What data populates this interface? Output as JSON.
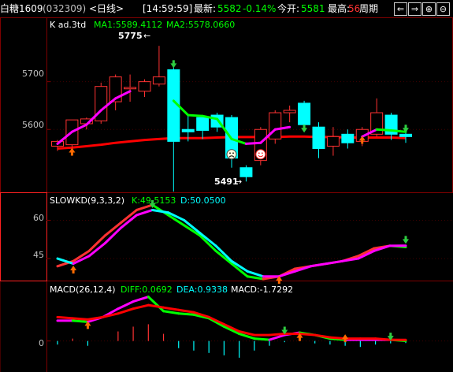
{
  "topbar": {
    "instrument": "白糖1609",
    "code": "(032309)",
    "period": "<日线>",
    "time": "[14:59:59]",
    "latest_label": "最新:",
    "latest_value": "5582",
    "change": "-0.14%",
    "open_label": "今开:",
    "open_value": "5581",
    "high_label": "最高:",
    "high_value": "56",
    "cycle_button": "周期",
    "nav_icons": [
      "arrow-left-icon",
      "arrow-right-icon",
      "zoom-in-icon",
      "zoom-out-icon"
    ],
    "nav_glyphs": [
      "⇐",
      "⇒",
      "⊕",
      "⊖"
    ]
  },
  "colors": {
    "background": "#000000",
    "grid": "#7f0000",
    "up": "#ff3232",
    "down": "#00ffff",
    "ma1": "#ff00ff",
    "ma2": "#00ff00",
    "ma_long": "#ff0000",
    "kdj_k": "#ff00ff",
    "kdj_d": "#00ffff",
    "diff": "#00ffff",
    "dea": "#ff0000"
  },
  "chart_data": [
    {
      "type": "candlestick",
      "title": "K  ad.3td",
      "legend": [
        {
          "label": "MA1:5589.4112",
          "color": "#00ff00"
        },
        {
          "label": "MA2:5578.0660",
          "color": "#00ff00"
        }
      ],
      "yticks": [
        5700,
        5600
      ],
      "ylim": [
        5475,
        5805
      ],
      "annotations": {
        "high": "5775",
        "low": "5491"
      },
      "candles": [
        {
          "o": 5565,
          "h": 5578,
          "l": 5555,
          "c": 5575
        },
        {
          "o": 5568,
          "h": 5605,
          "l": 5560,
          "c": 5620
        },
        {
          "o": 5612,
          "h": 5625,
          "l": 5600,
          "c": 5622
        },
        {
          "o": 5618,
          "h": 5698,
          "l": 5612,
          "c": 5690
        },
        {
          "o": 5658,
          "h": 5715,
          "l": 5640,
          "c": 5710
        },
        {
          "o": 5685,
          "h": 5715,
          "l": 5658,
          "c": 5688
        },
        {
          "o": 5680,
          "h": 5705,
          "l": 5668,
          "c": 5700
        },
        {
          "o": 5695,
          "h": 5775,
          "l": 5690,
          "c": 5710
        },
        {
          "o": 5725,
          "h": 5730,
          "l": 5470,
          "c": 5575
        },
        {
          "o": 5600,
          "h": 5630,
          "l": 5575,
          "c": 5595
        },
        {
          "o": 5625,
          "h": 5630,
          "l": 5580,
          "c": 5598
        },
        {
          "o": 5630,
          "h": 5635,
          "l": 5595,
          "c": 5605
        },
        {
          "o": 5625,
          "h": 5630,
          "l": 5520,
          "c": 5540
        },
        {
          "o": 5520,
          "h": 5525,
          "l": 5491,
          "c": 5501
        },
        {
          "o": 5535,
          "h": 5605,
          "l": 5525,
          "c": 5600
        },
        {
          "o": 5580,
          "h": 5640,
          "l": 5570,
          "c": 5635
        },
        {
          "o": 5635,
          "h": 5650,
          "l": 5615,
          "c": 5640
        },
        {
          "o": 5655,
          "h": 5660,
          "l": 5595,
          "c": 5610
        },
        {
          "o": 5605,
          "h": 5615,
          "l": 5540,
          "c": 5560
        },
        {
          "o": 5565,
          "h": 5605,
          "l": 5545,
          "c": 5585
        },
        {
          "o": 5590,
          "h": 5600,
          "l": 5560,
          "c": 5572
        },
        {
          "o": 5575,
          "h": 5605,
          "l": 5565,
          "c": 5600
        },
        {
          "o": 5590,
          "h": 5665,
          "l": 5585,
          "c": 5635
        },
        {
          "o": 5630,
          "h": 5635,
          "l": 5578,
          "c": 5590
        },
        {
          "o": 5590,
          "h": 5595,
          "l": 5572,
          "c": 5585
        }
      ],
      "ma1": [
        5570,
        5595,
        5610,
        5640,
        5665,
        5680,
        null,
        null,
        5660,
        5630,
        5628,
        5622,
        5580,
        5570,
        5572,
        5600,
        5605,
        null,
        null,
        null,
        null,
        5585,
        5600,
        5598,
        5595
      ],
      "ma_long": [
        5560,
        5562,
        5565,
        5568,
        5572,
        5575,
        5578,
        5580,
        5582,
        5582,
        5582,
        5583,
        5584,
        5584,
        5584,
        5584,
        5585,
        5585,
        5584,
        5584,
        5583,
        5583,
        5583,
        5583,
        5582
      ],
      "signals": [
        {
          "i": 1,
          "kind": "buy",
          "price": 5555
        },
        {
          "i": 8,
          "kind": "sell",
          "price": 5735
        },
        {
          "i": 12,
          "kind": "sad-face",
          "price": 5548
        },
        {
          "i": 14,
          "kind": "smile-face",
          "price": 5548
        },
        {
          "i": 17,
          "kind": "sell",
          "price": 5600
        },
        {
          "i": 21,
          "kind": "buy",
          "price": 5580
        },
        {
          "i": 24,
          "kind": "sell",
          "price": 5600
        }
      ]
    },
    {
      "type": "line",
      "title": "SLOWKD(9,3,3,2)",
      "legend": [
        {
          "label": "K:49.5153",
          "color": "#00ff00"
        },
        {
          "label": "D:50.0500",
          "color": "#00ffff"
        }
      ],
      "yticks": [
        60,
        45
      ],
      "ylim": [
        37,
        66
      ],
      "series": [
        {
          "name": "K",
          "values": [
            42,
            44,
            48,
            54,
            59,
            64,
            66,
            62,
            58,
            54,
            48,
            43,
            38,
            37,
            38,
            41,
            42,
            43,
            44,
            46,
            49,
            50,
            49.5
          ]
        },
        {
          "name": "D",
          "values": [
            45,
            43,
            46,
            51,
            57,
            62,
            64,
            63,
            60,
            55,
            50,
            44,
            40,
            38,
            38,
            40,
            42,
            43,
            44,
            45,
            48,
            50,
            50.05
          ]
        }
      ],
      "signals": [
        {
          "i": 1,
          "kind": "buy",
          "v": 41
        },
        {
          "i": 6,
          "kind": "sell",
          "v": 66
        },
        {
          "i": 14,
          "kind": "buy",
          "v": 37
        },
        {
          "i": 22,
          "kind": "sell",
          "v": 52
        }
      ]
    },
    {
      "type": "line",
      "title": "MACD(26,12,4)",
      "legend": [
        {
          "label": "DIFF:0.0692",
          "color": "#00ff00"
        },
        {
          "label": "DEA:0.9338",
          "color": "#00ffff"
        },
        {
          "label": "MACD:-1.7292",
          "color": "#ffffff"
        }
      ],
      "yticks": [
        0
      ],
      "ylim": [
        -22,
        40
      ],
      "series": [
        {
          "name": "DIFF",
          "values": [
            17,
            17,
            16,
            20,
            27,
            33,
            37,
            25,
            23,
            22,
            19,
            12,
            6,
            2,
            1,
            5,
            7,
            5,
            2,
            1,
            1,
            1,
            1,
            0.07
          ]
        },
        {
          "name": "DEA",
          "values": [
            20,
            19,
            18,
            20,
            23,
            27,
            30,
            28,
            26,
            24,
            20,
            14,
            8,
            5,
            5,
            6,
            6,
            5,
            3,
            2,
            2,
            2,
            1,
            0.93
          ]
        },
        {
          "name": "MACD",
          "values": [
            -3,
            2,
            -4,
            0,
            8,
            12,
            14,
            6,
            -6,
            -8,
            -10,
            -12,
            -14,
            -8,
            -4,
            -1,
            2,
            -2,
            -3,
            -4,
            -5,
            -3,
            -2,
            -1.73
          ]
        }
      ],
      "signals": [
        {
          "i": 2,
          "kind": "buy",
          "v": 14
        },
        {
          "i": 15,
          "kind": "sell",
          "v": 8
        },
        {
          "i": 16,
          "kind": "buy",
          "v": 4
        },
        {
          "i": 19,
          "kind": "buy",
          "v": 3
        },
        {
          "i": 22,
          "kind": "sell",
          "v": 3
        }
      ]
    }
  ]
}
